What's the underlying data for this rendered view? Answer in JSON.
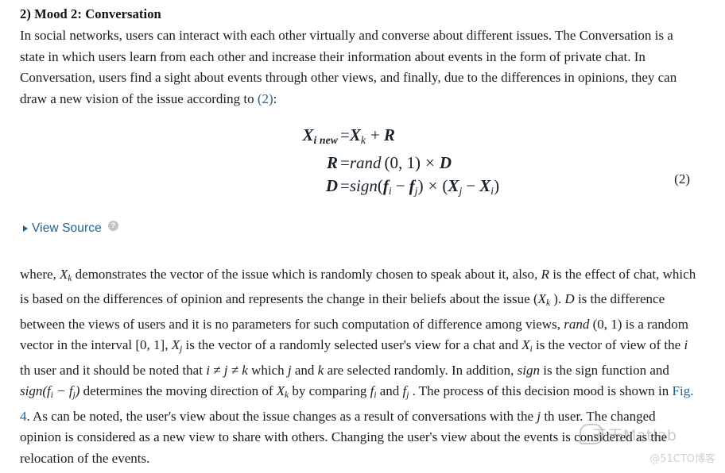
{
  "document": {
    "heading": "2) Mood 2: Conversation",
    "intro_paragraph": {
      "part1": "In social networks, users can interact with each other virtually and converse about different issues. The Conversation is a state in which users learn from each other and increase their information about events in the form of private chat. In Conversation, users find a sight about events through other views, and finally, due to the differences in opinions, they can draw a new vision of the issue according to ",
      "link": "(2)",
      "part2": ":"
    },
    "equation": {
      "number": "(2)",
      "lines": [
        {
          "lhs": "X",
          "lhs_sub": "i new",
          "rhs": "=X_k + R"
        },
        {
          "lhs": "R",
          "lhs_sub": "",
          "rhs": "=rand (0, 1) × D"
        },
        {
          "lhs": "D",
          "lhs_sub": "",
          "rhs": "=sign(f_i − f_j) × (X_j − X_i)"
        }
      ],
      "line1_lhs_var": "X",
      "line1_lhs_sub": "i new",
      "line1_eq": "=",
      "line1_rhs_var1": "X",
      "line1_rhs_sub1": "k",
      "line1_plus": "+",
      "line1_rhs_var2": "R",
      "line2_lhs_var": "R",
      "line2_eq": "=",
      "line2_func": "rand",
      "line2_args": "(0, 1)",
      "line2_times": "×",
      "line2_var": "D",
      "line3_lhs_var": "D",
      "line3_eq": "=",
      "line3_func": "sign",
      "line3_open": "(",
      "line3_f1": "f",
      "line3_f1_sub": "i",
      "line3_minus": "−",
      "line3_f2": "f",
      "line3_f2_sub": "j",
      "line3_close": ")",
      "line3_times": "×",
      "line3_open2": "(",
      "line3_x1": "X",
      "line3_x1_sub": "j",
      "line3_minus2": "−",
      "line3_x2": "X",
      "line3_x2_sub": "i",
      "line3_close2": ")"
    },
    "view_source": {
      "label": "View Source",
      "help_glyph": "?"
    },
    "body_paragraph": {
      "t1": "where, ",
      "m1": "X",
      "m1sub": "k",
      "t2": " demonstrates the vector of the issue which is randomly chosen to speak about it, also, ",
      "m2": "R",
      "t3": " is the effect of chat, which is based on the differences of opinion and represents the change in their beliefs about the issue (",
      "m3": "X",
      "m3sub": "k",
      "t4": " ). ",
      "m4": "D",
      "t5": " is the difference between the views of users and it is no parameters for such computation of difference among views, ",
      "m5": "rand",
      "t6": " (0, 1) is a random vector in the interval [0, 1], ",
      "m6": "X",
      "m6sub": "j",
      "t7": " is the vector of a randomly selected user's view for a chat and ",
      "m7": "X",
      "m7sub": "i",
      "t8": " is the vector of view of the ",
      "m8": "i",
      "t9": " th user and it should be noted that ",
      "m9": "i ≠ j ≠ k",
      "t10": " which ",
      "m10": "j",
      "t11": " and ",
      "m11": "k",
      "t12": " are selected randomly. In addition, ",
      "m12": "sign",
      "t13": " is the sign function and ",
      "m13": "sign(f",
      "m13sub": "i",
      "m13b": " − f",
      "m13sub2": "j",
      "m13c": ")",
      "t14": " determines the moving direction of ",
      "m14": "X",
      "m14sub": "k",
      "t15": " by comparing ",
      "m15": "f",
      "m15sub": "i",
      "t16": " and ",
      "m16": "f",
      "m16sub": "j",
      "t17": " . The process of this decision mood is shown in ",
      "link": "Fig. 4",
      "t18": ". As can be noted, the user's view about the issue changes as a result of conversations with the ",
      "m17": "j",
      "t19": " th user. The changed opinion is considered as a new view to share with others. Changing the user's view about the events is considered as the relocation of the events."
    }
  },
  "watermark": {
    "main_text": "天天Matlab",
    "sub_text": "@51CTO博客"
  },
  "colors": {
    "link": "#1a6496",
    "text": "#1c1c1c",
    "background": "#ffffff"
  }
}
